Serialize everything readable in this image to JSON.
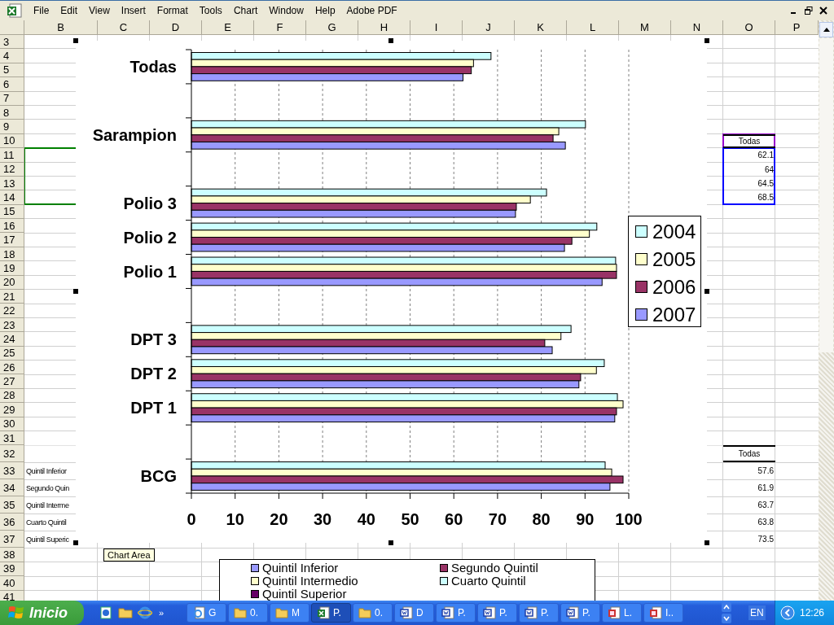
{
  "menu_bar": {
    "items": [
      "File",
      "Edit",
      "View",
      "Insert",
      "Format",
      "Tools",
      "Chart",
      "Window",
      "Help",
      "Adobe PDF"
    ]
  },
  "sheet": {
    "columns": [
      "B",
      "C",
      "D",
      "E",
      "F",
      "G",
      "H",
      "I",
      "J",
      "K",
      "L",
      "M",
      "N",
      "O",
      "P"
    ],
    "source_ranges": [
      {
        "kind": "categories",
        "color": "#008000"
      },
      {
        "kind": "series_name",
        "color": "#9900cc"
      },
      {
        "kind": "values",
        "color": "#0000ff"
      }
    ],
    "rows": [
      {
        "number": "3"
      },
      {
        "number": "4"
      },
      {
        "number": "5"
      },
      {
        "number": "6"
      },
      {
        "number": "7"
      },
      {
        "number": "8"
      },
      {
        "number": "9"
      },
      {
        "number": "10",
        "O": {
          "text": "Todas",
          "kind": "header"
        }
      },
      {
        "number": "11",
        "O": {
          "text": "62.1",
          "kind": "number"
        }
      },
      {
        "number": "12",
        "O": {
          "text": "64",
          "kind": "number"
        }
      },
      {
        "number": "13",
        "O": {
          "text": "64.5",
          "kind": "number"
        }
      },
      {
        "number": "14",
        "O": {
          "text": "68.5",
          "kind": "number"
        }
      },
      {
        "number": "15"
      },
      {
        "number": "16"
      },
      {
        "number": "17"
      },
      {
        "number": "18"
      },
      {
        "number": "19"
      },
      {
        "number": "20"
      },
      {
        "number": "21"
      },
      {
        "number": "22"
      },
      {
        "number": "23"
      },
      {
        "number": "24"
      },
      {
        "number": "25"
      },
      {
        "number": "26"
      },
      {
        "number": "27"
      },
      {
        "number": "28"
      },
      {
        "number": "29"
      },
      {
        "number": "30"
      },
      {
        "number": "31"
      },
      {
        "number": "32",
        "O": {
          "text": "Todas",
          "kind": "header"
        }
      },
      {
        "number": "33",
        "B": {
          "text": "Quintil Inferior",
          "kind": "label"
        },
        "O": {
          "text": "57.6",
          "kind": "number"
        }
      },
      {
        "number": "34",
        "B": {
          "text": "Segundo Quin",
          "kind": "label"
        },
        "O": {
          "text": "61.9",
          "kind": "number"
        }
      },
      {
        "number": "35",
        "B": {
          "text": "Quintil Interme",
          "kind": "label"
        },
        "O": {
          "text": "63.7",
          "kind": "number"
        }
      },
      {
        "number": "36",
        "B": {
          "text": "Cuarto Quintil",
          "kind": "label"
        },
        "O": {
          "text": "63.8",
          "kind": "number"
        }
      },
      {
        "number": "37",
        "B": {
          "text": "Quintil Superic",
          "kind": "label"
        },
        "O": {
          "text": "73.5",
          "kind": "number"
        }
      },
      {
        "number": "38"
      },
      {
        "number": "39"
      },
      {
        "number": "40"
      },
      {
        "number": "41"
      }
    ]
  },
  "chart": {
    "chart_data": {
      "type": "bar",
      "orientation": "horizontal",
      "grid": true,
      "legend": "right",
      "categories": [
        "Todas",
        null,
        "Sarampion",
        null,
        "Polio 3",
        "Polio 2",
        "Polio 1",
        null,
        "DPT 3",
        "DPT 2",
        "DPT 1",
        null,
        "BCG"
      ],
      "xlim": [
        0,
        100
      ],
      "xticks": [
        0,
        10,
        20,
        30,
        40,
        50,
        60,
        70,
        80,
        90,
        100
      ],
      "series": [
        {
          "name": "2004",
          "color": "#ccffff",
          "values": [
            68.5,
            null,
            90.1,
            null,
            81.2,
            92.7,
            97,
            null,
            86.8,
            94.4,
            97.4,
            null,
            94.6
          ]
        },
        {
          "name": "2005",
          "color": "#ffffcc",
          "values": [
            64.5,
            null,
            84,
            null,
            77.5,
            91,
            97.2,
            null,
            84.5,
            92.6,
            98.7,
            null,
            96.1
          ]
        },
        {
          "name": "2006",
          "color": "#993366",
          "values": [
            64,
            null,
            82.7,
            null,
            74.3,
            87,
            97.2,
            null,
            80.8,
            89,
            97.2,
            null,
            98.7
          ]
        },
        {
          "name": "2007",
          "color": "#9999ff",
          "values": [
            62.1,
            null,
            85.5,
            null,
            74.1,
            85.3,
            93.9,
            null,
            82.5,
            88.6,
            96.8,
            null,
            95.7
          ]
        }
      ]
    }
  },
  "tooltip": {
    "text": "Chart Area"
  },
  "quintile_legend": {
    "items": [
      {
        "label": "Quintil Inferior",
        "color": "#9999ff"
      },
      {
        "label": "Segundo Quintil",
        "color": "#993366"
      },
      {
        "label": "Quintil Intermedio",
        "color": "#ffffcc"
      },
      {
        "label": "Cuarto Quintil",
        "color": "#ccffff"
      },
      {
        "label": "Quintil Superior",
        "color": "#660066"
      }
    ]
  },
  "taskbar": {
    "start_label": "Inicio",
    "more": "»",
    "buttons": [
      {
        "label": "G",
        "kind": "browser",
        "selected": false
      },
      {
        "label": "0.",
        "kind": "folder",
        "selected": false
      },
      {
        "label": "M",
        "kind": "folder",
        "selected": false
      },
      {
        "label": "P.",
        "kind": "spreadsheet",
        "selected": true
      },
      {
        "label": "0.",
        "kind": "folder",
        "selected": false
      },
      {
        "label": "D",
        "kind": "document",
        "selected": false
      },
      {
        "label": "P.",
        "kind": "document",
        "selected": false
      },
      {
        "label": "P.",
        "kind": "document",
        "selected": false
      },
      {
        "label": "P.",
        "kind": "document",
        "selected": false
      },
      {
        "label": "P.",
        "kind": "document",
        "selected": false
      },
      {
        "label": "L.",
        "kind": "slides",
        "selected": false
      },
      {
        "label": "I..",
        "kind": "slides",
        "selected": false
      }
    ],
    "language": "EN",
    "clock": "12:26"
  }
}
